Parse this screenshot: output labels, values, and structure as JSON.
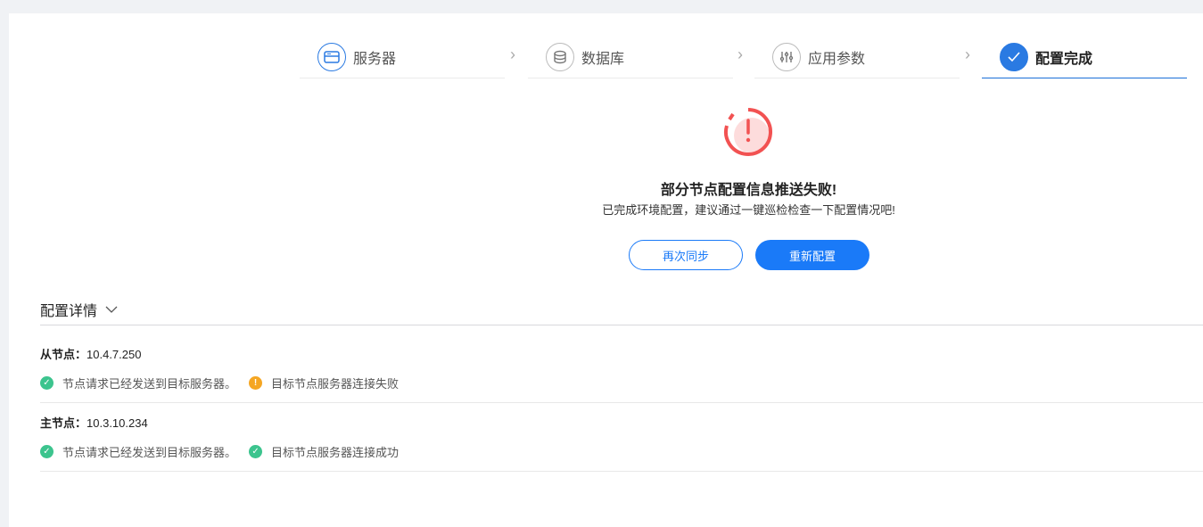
{
  "steps": [
    {
      "label": "服务器",
      "icon": "server-icon"
    },
    {
      "label": "数据库",
      "icon": "database-icon"
    },
    {
      "label": "应用参数",
      "icon": "sliders-icon"
    },
    {
      "label": "配置完成",
      "icon": "check-icon"
    }
  ],
  "result": {
    "title": "部分节点配置信息推送失败!",
    "subtitle": "已完成环境配置，建议通过一键巡检检查一下配置情况吧!",
    "resync_label": "再次同步",
    "reconfigure_label": "重新配置"
  },
  "details": {
    "title": "配置详情",
    "nodes": [
      {
        "label": "从节点：",
        "ip": "10.4.7.250",
        "statuses": [
          {
            "text": "节点请求已经发送到目标服务器。",
            "state": "success"
          },
          {
            "text": "目标节点服务器连接失败",
            "state": "warning"
          }
        ]
      },
      {
        "label": "主节点：",
        "ip": "10.3.10.234",
        "statuses": [
          {
            "text": "节点请求已经发送到目标服务器。",
            "state": "success"
          },
          {
            "text": "目标节点服务器连接成功",
            "state": "success"
          }
        ]
      }
    ]
  },
  "colors": {
    "primary": "#1a7af8",
    "success": "#3cc48e",
    "warning": "#f5a623",
    "error": "#f25252"
  }
}
